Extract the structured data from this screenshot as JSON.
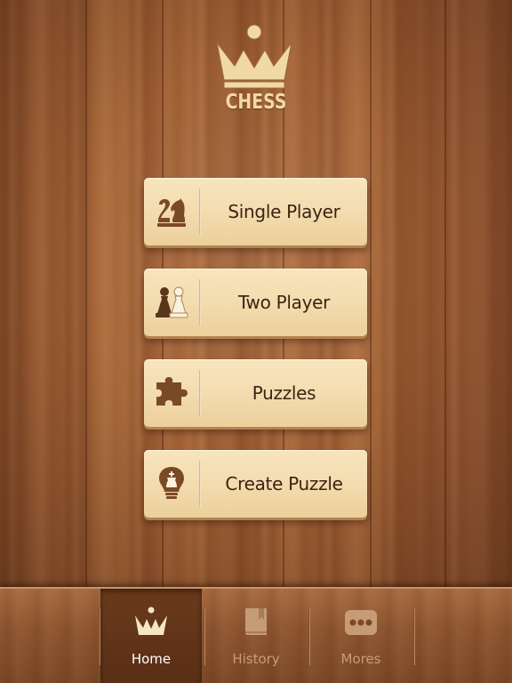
{
  "app": {
    "logo_text": "CHESS"
  },
  "menu": {
    "items": [
      {
        "label": "Single Player",
        "icon": "knight-two-icon"
      },
      {
        "label": "Two Player",
        "icon": "two-pawns-icon"
      },
      {
        "label": "Puzzles",
        "icon": "puzzle-piece-icon"
      },
      {
        "label": "Create Puzzle",
        "icon": "lightbulb-king-icon"
      }
    ]
  },
  "tabbar": {
    "tabs": [
      {
        "label": "Home",
        "icon": "crown-icon",
        "active": true
      },
      {
        "label": "History",
        "icon": "book-icon",
        "active": false
      },
      {
        "label": "Mores",
        "icon": "ellipsis-icon",
        "active": false
      }
    ]
  },
  "colors": {
    "logo_gold": "#f1d9a6",
    "button_face": "#f3dcaf",
    "button_text": "#3b2412",
    "icon_brown": "#7a4a26",
    "tab_active_text": "#ffffff",
    "tab_inactive_text": "#c69c76"
  }
}
